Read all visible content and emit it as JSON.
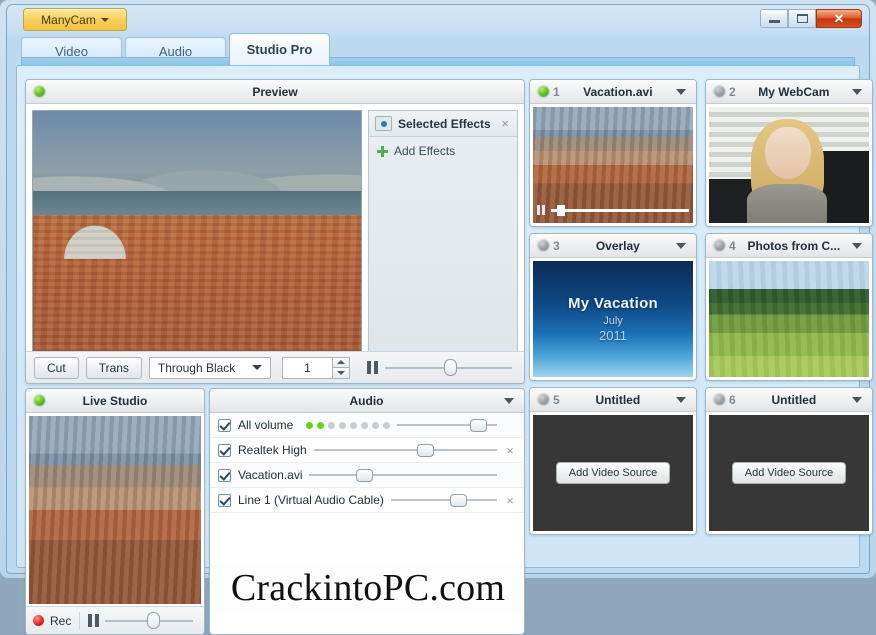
{
  "window": {
    "menu_button": "ManyCam",
    "minimize": "minimize",
    "maximize": "maximize",
    "close": "✕"
  },
  "tabs": [
    {
      "label": "Video",
      "active": false
    },
    {
      "label": "Audio",
      "active": false
    },
    {
      "label": "Studio Pro",
      "active": true
    }
  ],
  "preview": {
    "title": "Preview",
    "status_led": "on",
    "effects": {
      "title": "Selected Effects",
      "close": "×",
      "add_label": "Add Effects"
    },
    "toolbar": {
      "cut_label": "Cut",
      "trans_label": "Trans",
      "transition_value": "Through Black",
      "duration_value": "1",
      "pause_label": "pause",
      "volume_percent": 52
    }
  },
  "sources": [
    {
      "number": "1",
      "title": "Vacation.avi",
      "led": "on",
      "kind": "video",
      "progress": 4
    },
    {
      "number": "2",
      "title": "My WebCam",
      "led": "off",
      "kind": "webcam"
    },
    {
      "number": "3",
      "title": "Overlay",
      "led": "off",
      "kind": "overlay",
      "overlay": {
        "title": "My Vacation",
        "subtitle": "July",
        "year": "2011"
      }
    },
    {
      "number": "4",
      "title": "Photos from C...",
      "led": "off",
      "kind": "photo"
    },
    {
      "number": "5",
      "title": "Untitled",
      "led": "off",
      "kind": "empty",
      "add_label": "Add Video Source"
    },
    {
      "number": "6",
      "title": "Untitled",
      "led": "off",
      "kind": "empty",
      "add_label": "Add Video Source"
    }
  ],
  "live_studio": {
    "title": "Live Studio",
    "status_led": "on",
    "rec_label": "Rec",
    "pause_label": "pause",
    "volume_percent": 55
  },
  "audio": {
    "title": "Audio",
    "rows": [
      {
        "label": "All volume",
        "checked": true,
        "volume_percent": 88,
        "has_meter": true,
        "meter_lit": 2,
        "meter_total": 8,
        "closable": false
      },
      {
        "label": "Realtek High",
        "checked": true,
        "volume_percent": 62,
        "has_meter": false,
        "closable": true
      },
      {
        "label": "Vacation.avi",
        "checked": true,
        "volume_percent": 27,
        "has_meter": false,
        "closable": false
      },
      {
        "label": "Line 1 (Virtual Audio Cable)",
        "checked": true,
        "volume_percent": 66,
        "has_meter": false,
        "closable": true
      }
    ]
  },
  "watermark": {
    "text": "CrackintoPC.com"
  },
  "colors": {
    "accent": "#87c4e6",
    "menu_yellow": "#f6cd56",
    "led_on": "#49b512",
    "led_off": "#8d9699",
    "close_red": "#c63812",
    "rec_red": "#d71f1f"
  }
}
